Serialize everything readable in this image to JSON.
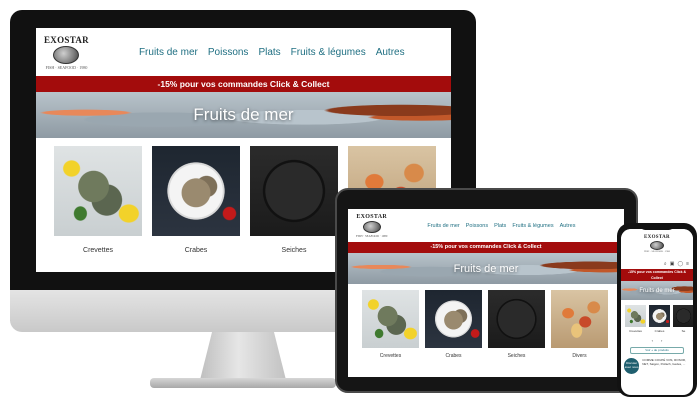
{
  "brand": {
    "name": "EXOSTAR",
    "tagline": "FISH · SEAFOOD · 1980"
  },
  "nav": {
    "items": [
      "Fruits de mer",
      "Poissons",
      "Plats",
      "Fruits & légumes",
      "Autres"
    ]
  },
  "promo": "-15% pour vos commandes Click & Collect",
  "hero": {
    "title": "Fruits de mer"
  },
  "categories": {
    "desktop": [
      "Crevettes",
      "Crabes",
      "Seiches"
    ],
    "tablet": [
      "Crevettes",
      "Crabes",
      "Seiches",
      "Divers"
    ],
    "phone": [
      "Crevettes",
      "Crabes",
      "Se"
    ]
  },
  "phone": {
    "toolbar_icons": [
      "search-icon",
      "cart-icon",
      "user-icon"
    ],
    "pager": [
      "‹",
      "›"
    ],
    "more_label": "Voir + de produits",
    "chat_label": "Discuter avec nous",
    "cookie_text": "COMME COUPÉ VOS, ROSOR, NET, Saigon, Potlach, Gedes, ..."
  },
  "colors": {
    "promo_bg": "#a30c0c",
    "nav_link": "#1f6f82"
  }
}
